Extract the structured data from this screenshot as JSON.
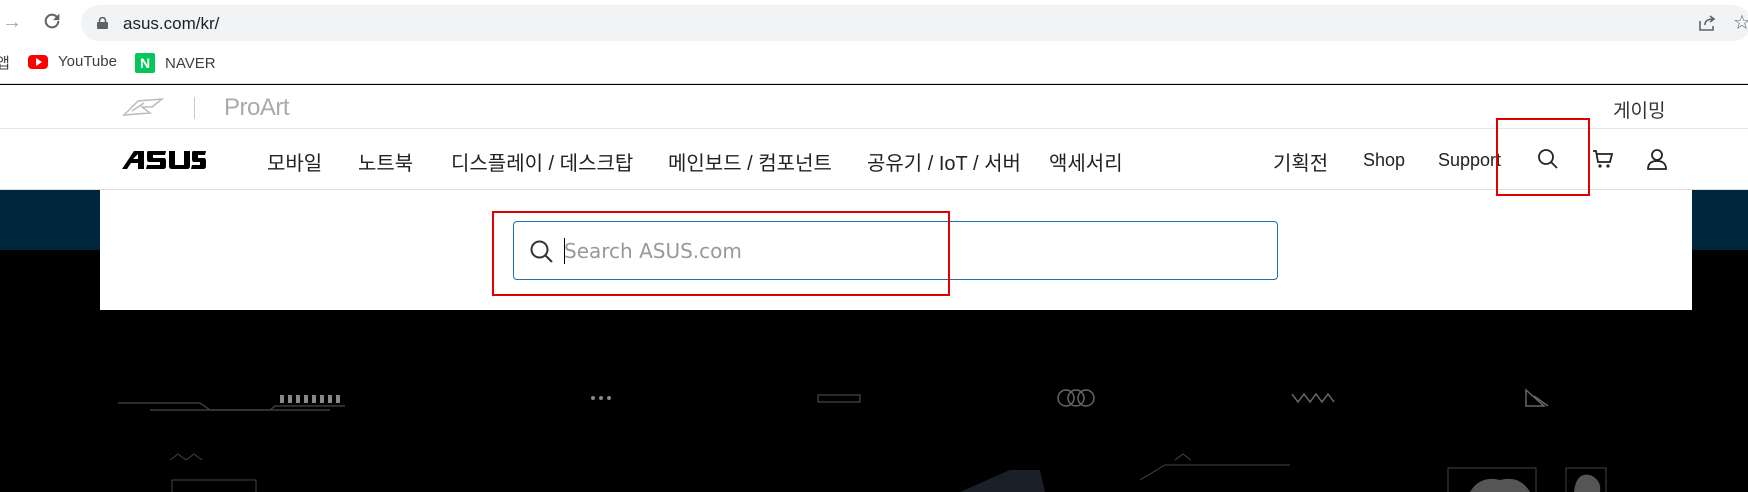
{
  "browser": {
    "url": "asus.com/kr/",
    "bookmarks": [
      {
        "label": "YouTube",
        "icon": "youtube-icon"
      },
      {
        "label": "NAVER",
        "icon": "naver-icon"
      }
    ],
    "apps_label": "앱"
  },
  "topbar": {
    "proart": "ProArt",
    "gaming": "게이밍"
  },
  "nav": {
    "items": [
      "모바일",
      "노트북",
      "디스플레이 / 데스크탑",
      "메인보드 / 컴포넌트",
      "공유기 / IoT / 서버",
      "액세서리"
    ],
    "right": [
      "기획전",
      "Shop",
      "Support"
    ]
  },
  "search": {
    "placeholder": "Search ASUS.com"
  },
  "colors": {
    "annotation": "#e00000",
    "search_border": "#1a6fb4",
    "band": "#00263e"
  }
}
